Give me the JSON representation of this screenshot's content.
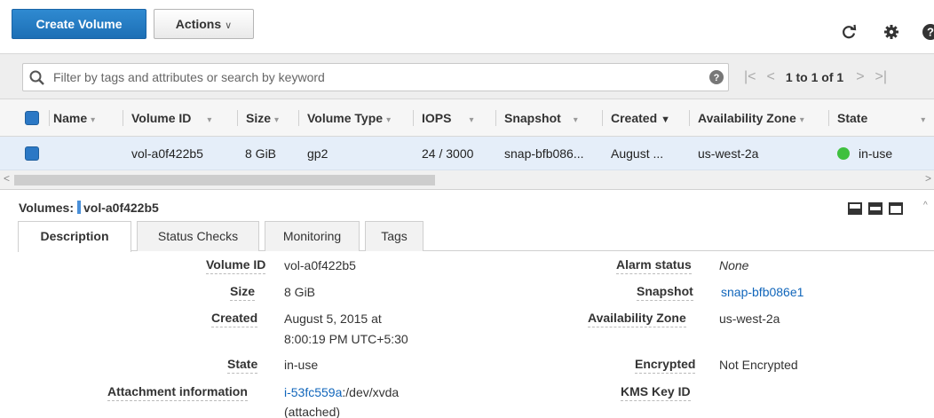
{
  "toolbar": {
    "create_label": "Create Volume",
    "actions_label": "Actions",
    "actions_caret": "∨",
    "icons": [
      "refresh-icon",
      "gear-icon",
      "help-icon"
    ]
  },
  "filter": {
    "placeholder": "Filter by tags and attributes or search by keyword",
    "pager_first": "|<",
    "pager_prev": "<",
    "pager_count": "1 to 1 of 1",
    "pager_next": ">",
    "pager_last": ">|"
  },
  "table": {
    "headers": {
      "name": "Name",
      "volume_id": "Volume ID",
      "size": "Size",
      "volume_type": "Volume Type",
      "iops": "IOPS",
      "snapshot": "Snapshot",
      "created": "Created",
      "az": "Availability Zone",
      "state": "State"
    },
    "rows": [
      {
        "name": "",
        "volume_id": "vol-a0f422b5",
        "size": "8 GiB",
        "volume_type": "gp2",
        "iops": "24 / 3000",
        "snapshot": "snap-bfb086...",
        "created": "August ...",
        "az": "us-west-2a",
        "state": "in-use",
        "state_color": "#3fc03f"
      }
    ]
  },
  "detail": {
    "title_prefix": "Volumes:",
    "title_id": "vol-a0f422b5",
    "tabs": [
      "Description",
      "Status Checks",
      "Monitoring",
      "Tags"
    ],
    "left": {
      "volume_id_label": "Volume ID",
      "volume_id": "vol-a0f422b5",
      "size_label": "Size",
      "size": "8 GiB",
      "created_label": "Created",
      "created_line1": "August 5, 2015 at",
      "created_line2": "8:00:19 PM UTC+5:30",
      "state_label": "State",
      "state": "in-use",
      "attachment_label": "Attachment information",
      "attachment_link": "i-53fc559a",
      "attachment_rest": ":/dev/xvda",
      "attachment_line2": "(attached)"
    },
    "right": {
      "alarm_label": "Alarm status",
      "alarm": "None",
      "snapshot_label": "Snapshot",
      "snapshot": "snap-bfb086e1",
      "az_label": "Availability Zone",
      "az": "us-west-2a",
      "encrypted_label": "Encrypted",
      "encrypted": "Not Encrypted",
      "kms_label": "KMS Key ID",
      "kms": ""
    }
  },
  "colors": {
    "primary": "#1d6fb5",
    "link": "#1166bb",
    "selected_row": "#e5eef9",
    "status_green": "#3fc03f"
  }
}
